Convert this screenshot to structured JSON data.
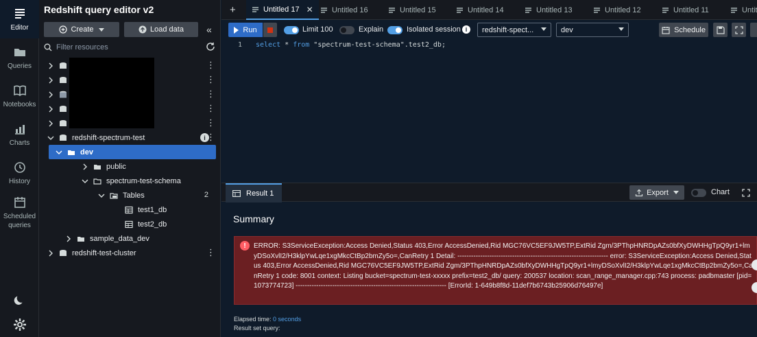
{
  "rail": {
    "items": [
      {
        "label": "Editor",
        "icon": "editor-icon"
      },
      {
        "label": "Queries",
        "icon": "folder-icon"
      },
      {
        "label": "Notebooks",
        "icon": "book-icon"
      },
      {
        "label": "Charts",
        "icon": "chart-icon"
      },
      {
        "label": "History",
        "icon": "clock-icon"
      },
      {
        "label": "Scheduled queries",
        "icon": "calendar-icon"
      }
    ],
    "theme_icon": "moon-icon",
    "settings_icon": "gear-icon"
  },
  "panel": {
    "title": "Redshift query editor v2",
    "create_label": "Create",
    "load_data_label": "Load data",
    "filter_placeholder": "Filter resources",
    "tree": {
      "cluster1": "redshift-spectrum-test",
      "db": "dev",
      "schema_public": "public",
      "schema_spectrum": "spectrum-test-schema",
      "tables_label": "Tables",
      "tables_count": "2",
      "table1": "test1_db",
      "table2": "test2_db",
      "sample_db": "sample_data_dev",
      "cluster2": "redshift-test-cluster"
    }
  },
  "tabs": [
    "Untitled 17",
    "Untitled 16",
    "Untitled 15",
    "Untitled 14",
    "Untitled 13",
    "Untitled 12",
    "Untitled 11",
    "Untitl"
  ],
  "toolbar": {
    "run_label": "Run",
    "limit_label": "Limit 100",
    "explain_label": "Explain",
    "isolated_label": "Isolated session",
    "connection": "redshift-spect...",
    "database": "dev",
    "schedule_label": "Schedule"
  },
  "editor": {
    "line_number": "1",
    "kw_select": "select",
    "star": " * ",
    "kw_from": "from",
    "rest": " \"spectrum-test-schema\".test2_db;"
  },
  "result": {
    "tab_label": "Result 1",
    "export_label": "Export",
    "chart_label": "Chart",
    "summary_title": "Summary",
    "error_text": "ERROR: S3ServiceException:Access Denied,Status 403,Error AccessDenied,Rid MGC76VC5EF9JW5TP,ExtRid Zgm/3PThpHNRDpAZs0bfXyDWHHgTpQ9yr1+lmyDSoXvlI2/H3klpYwLqe1xgMkcCtBp2bmZy5o=,CanRetry 1 Detail: ------------------------------------------------------------------ error: S3ServiceException:Access Denied,Status 403,Error AccessDenied,Rid MGC76VC5EF9JW5TP,ExtRid Zgm/3PThpHNRDpAZs0bfXyDWHHgTpQ9yr1+lmyDSoXvlI2/H3klpYwLqe1xgMkcCtBp2bmZy5o=,CanRetry 1 code: 8001 context: Listing bucket=spectrum-test-xxxxx prefix=test2_db/ query: 200537 location: scan_range_manager.cpp:743 process: padbmaster [pid=1073774723] ------------------------------------------------------------------ [ErrorId: 1-649b8f8d-11def7b6743b25906d76497e]",
    "elapsed_label": "Elapsed time:",
    "elapsed_value": "0 seconds",
    "result_set_label": "Result set query:"
  }
}
